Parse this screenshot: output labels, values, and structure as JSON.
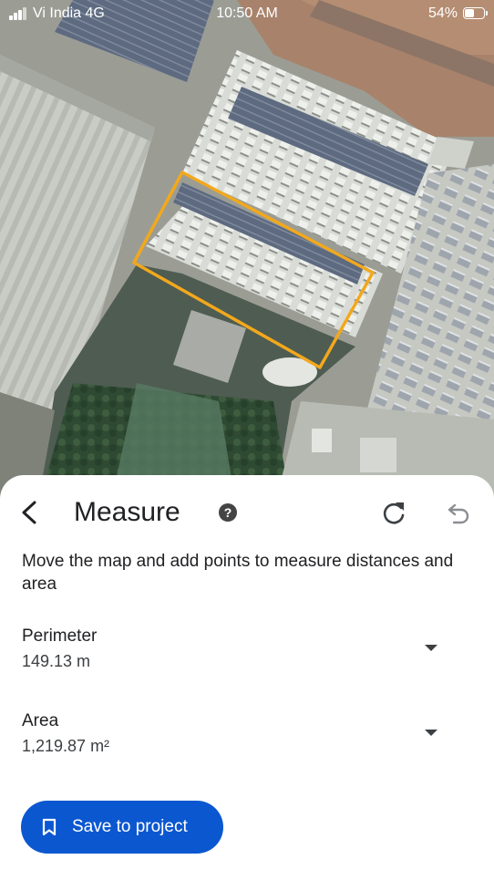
{
  "status_bar": {
    "carrier": "Vi India  4G",
    "time": "10:50 AM",
    "battery_percent": "54%",
    "battery_level": 0.54
  },
  "map": {
    "selection_color": "#f2a81d"
  },
  "sheet": {
    "title": "Measure",
    "instructions": "Move the map and add points to measure distances and area",
    "perimeter": {
      "label": "Perimeter",
      "value": "149.13 m"
    },
    "area": {
      "label": "Area",
      "value": "1,219.87 m²"
    },
    "save_button": {
      "label": "Save to project"
    },
    "icons": [
      "back-arrow",
      "help",
      "redo",
      "undo",
      "bookmark",
      "dropdown-arrow"
    ]
  },
  "colors": {
    "accent": "#0b57d0",
    "sheet_bg": "#ffffff"
  }
}
